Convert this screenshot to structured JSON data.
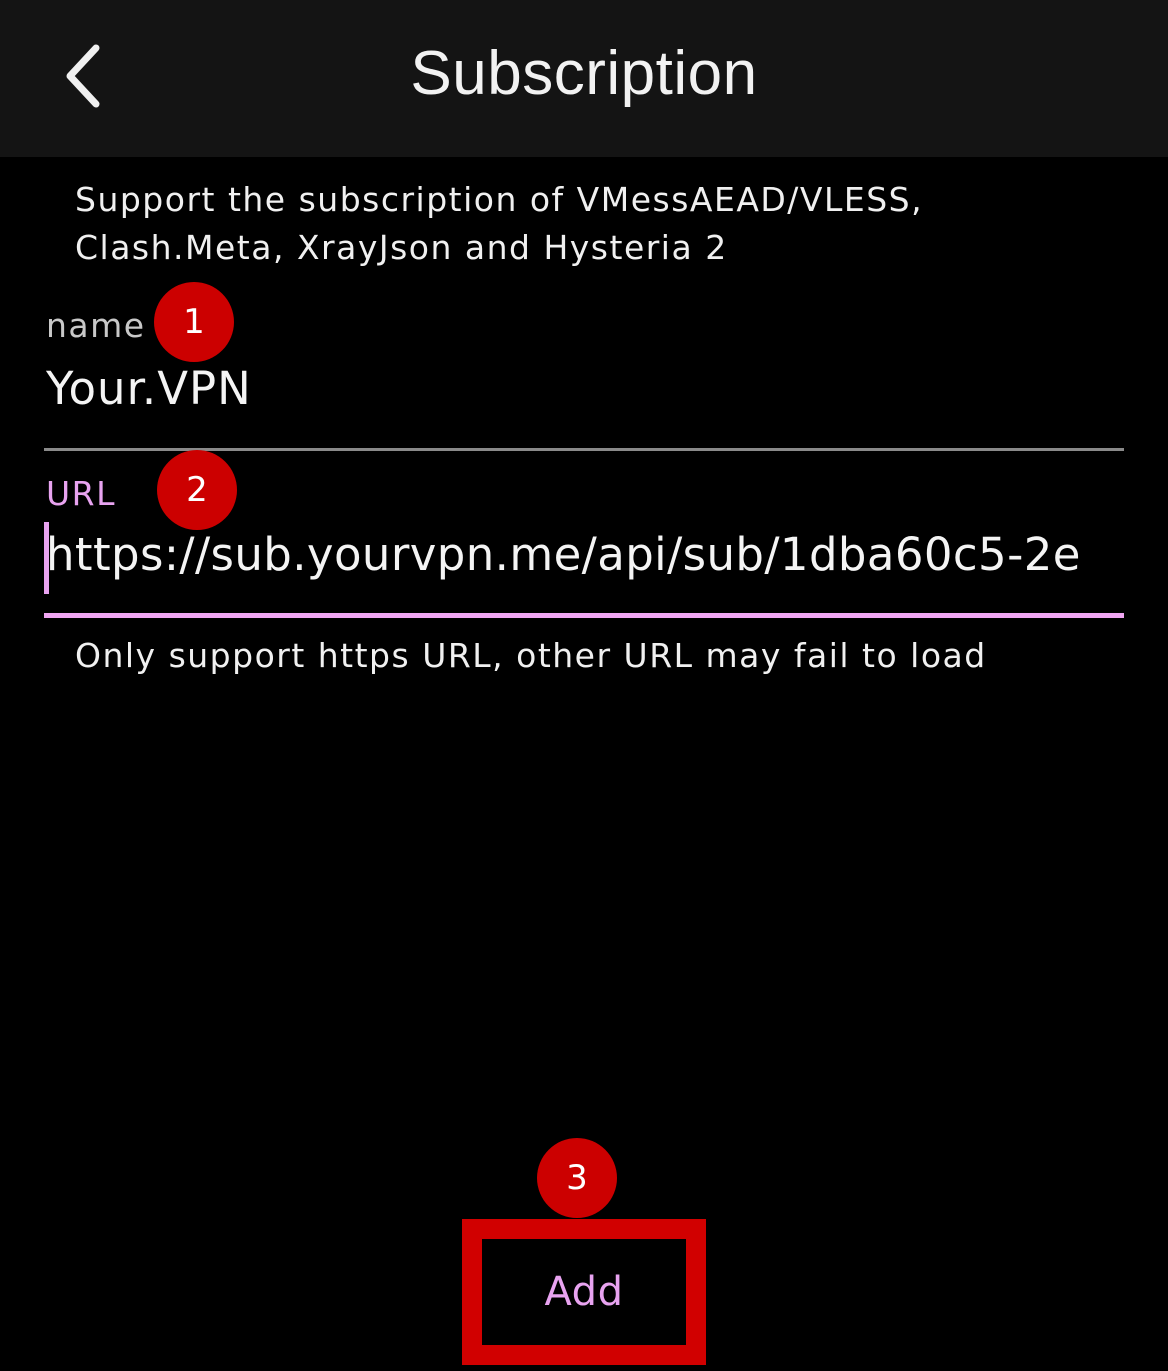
{
  "header": {
    "title": "Subscription",
    "back_icon": "chevron-left-icon"
  },
  "intro_text": "Support the subscription of VMessAEAD/VLESS, Clash.Meta, XrayJson and Hysteria 2",
  "name_field": {
    "label": "name",
    "value": "Your.VPN"
  },
  "url_field": {
    "label": "URL",
    "value": "https://sub.yourvpn.me/api/sub/1dba60c5-2e"
  },
  "hint_text": "Only support https URL, other URL may fail to load",
  "markers": [
    "1",
    "2",
    "3"
  ],
  "add_button": {
    "label": "Add"
  },
  "colors": {
    "accent": "#e8a3f0",
    "marker": "#cc0000",
    "highlight": "#d10000",
    "header_bg": "#141414"
  }
}
